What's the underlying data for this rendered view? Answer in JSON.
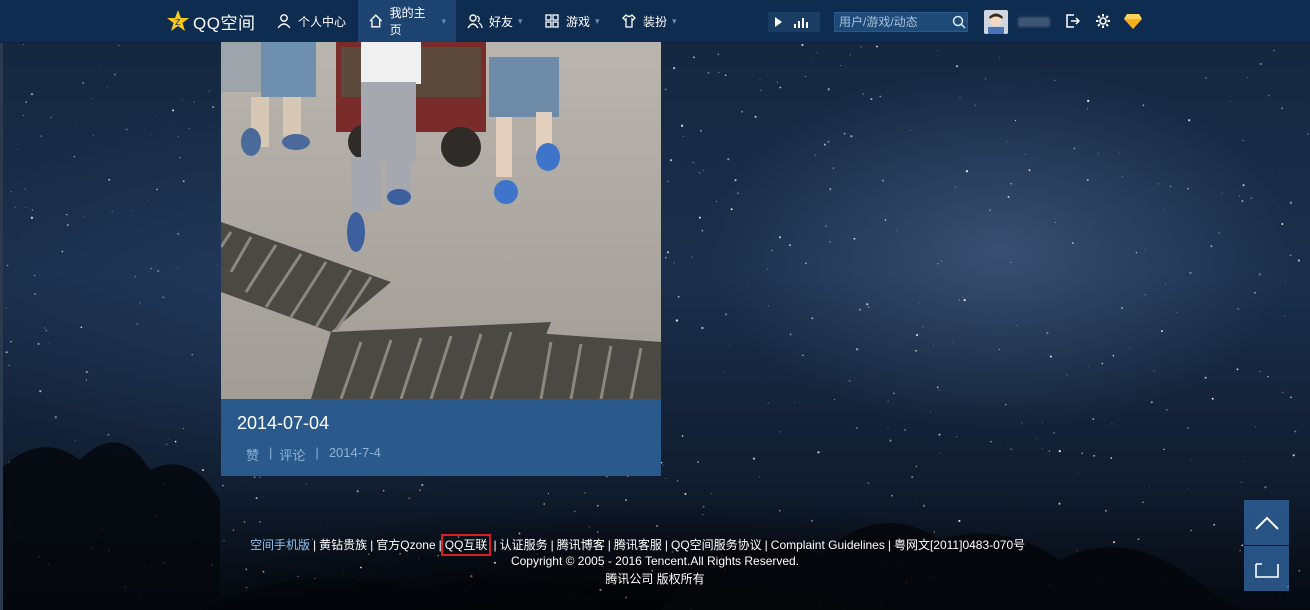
{
  "app": {
    "logo_text": "QQ空间"
  },
  "nav": {
    "items": [
      {
        "label": "个人中心",
        "icon": "person-icon"
      },
      {
        "label": "我的主页",
        "icon": "home-icon"
      },
      {
        "label": "好友",
        "icon": "friends-icon"
      },
      {
        "label": "游戏",
        "icon": "game-grid-icon"
      },
      {
        "label": "装扮",
        "icon": "shirt-icon"
      }
    ],
    "search_placeholder": "用户/游戏/动态"
  },
  "card": {
    "title": "2014-07-04",
    "like_label": "赞",
    "comment_label": "评论",
    "date": "2014-7-4"
  },
  "footer": {
    "links": [
      "空间手机版",
      "黄钻贵族",
      "官方Qzone",
      "QQ互联",
      "认证服务",
      "腾讯博客",
      "腾讯客服",
      "QQ空间服务协议",
      "Complaint Guidelines",
      "粤网文[2011]0483-070号"
    ],
    "copyright": "Copyright © 2005 - 2016 Tencent.All Rights Reserved.",
    "company": "腾讯公司 版权所有"
  },
  "colors": {
    "nav_bg": "#0e2c4f",
    "card_bg": "#2a5a8c",
    "highlight": "#d81e1e"
  }
}
